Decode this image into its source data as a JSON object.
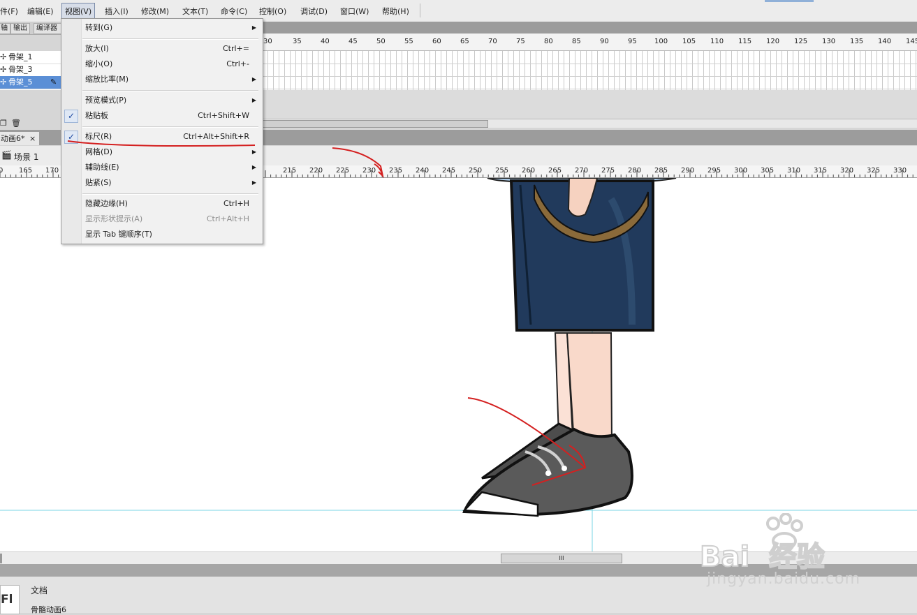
{
  "menubar": {
    "items": [
      "件(F)",
      "编辑(E)",
      "视图(V)",
      "插入(I)",
      "修改(M)",
      "文本(T)",
      "命令(C)",
      "控制(O)",
      "调试(D)",
      "窗口(W)",
      "帮助(H)"
    ]
  },
  "view_menu": {
    "goto": {
      "label": "转到(G)"
    },
    "zoom_in": {
      "label": "放大(I)",
      "shortcut": "Ctrl+="
    },
    "zoom_out": {
      "label": "缩小(O)",
      "shortcut": "Ctrl+-"
    },
    "magnification": {
      "label": "缩放比率(M)"
    },
    "preview_mode": {
      "label": "预览模式(P)"
    },
    "pasteboard": {
      "label": "粘贴板",
      "shortcut": "Ctrl+Shift+W",
      "checked": true
    },
    "rulers": {
      "label": "标尺(R)",
      "shortcut": "Ctrl+Alt+Shift+R",
      "checked": true
    },
    "grid": {
      "label": "网格(D)"
    },
    "guides": {
      "label": "辅助线(E)"
    },
    "snapping": {
      "label": "贴紧(S)"
    },
    "hide_edges": {
      "label": "隐藏边缘(H)",
      "shortcut": "Ctrl+H"
    },
    "show_shape_hints": {
      "label": "显示形状提示(A)",
      "shortcut": "Ctrl+Alt+H",
      "disabled": true
    },
    "show_tab_order": {
      "label": "显示 Tab 键顺序(T)"
    }
  },
  "panel_tabs": [
    "轴",
    "输出",
    "编译器错"
  ],
  "timeline": {
    "frame_numbers": [
      "30",
      "35",
      "40",
      "45",
      "50",
      "55",
      "60",
      "65",
      "70",
      "75",
      "80",
      "85",
      "90",
      "95",
      "100",
      "105",
      "110",
      "115",
      "120",
      "125",
      "130",
      "135",
      "140",
      "145"
    ],
    "layers": [
      {
        "name": "骨架_1",
        "selected": false
      },
      {
        "name": "骨架_3",
        "selected": false
      },
      {
        "name": "骨架_5",
        "selected": true
      }
    ]
  },
  "document_tab": {
    "label": "动画6*",
    "close": "×"
  },
  "scene": {
    "label": "场景 1"
  },
  "stage_ruler": {
    "labels": [
      "0",
      "165",
      "170",
      "215",
      "220",
      "225",
      "230",
      "235",
      "240",
      "245",
      "250",
      "255",
      "260",
      "265",
      "270",
      "275",
      "280",
      "285",
      "290",
      "295",
      "300",
      "305",
      "310",
      "315",
      "320",
      "325",
      "330"
    ]
  },
  "scrollbar": {
    "thumb_grip": "III"
  },
  "properties": {
    "logo": "Fl",
    "type_label": "文档",
    "doc_name": "骨骼动画6"
  },
  "watermark": {
    "brand": "Bai  经验",
    "url": "jingyan.baidu.com"
  },
  "colors": {
    "selection": "#5b8fd6",
    "guide": "#79d6e6",
    "annotation": "#d42020",
    "skirt": "#213a5c",
    "shoe": "#5a5a5a"
  }
}
